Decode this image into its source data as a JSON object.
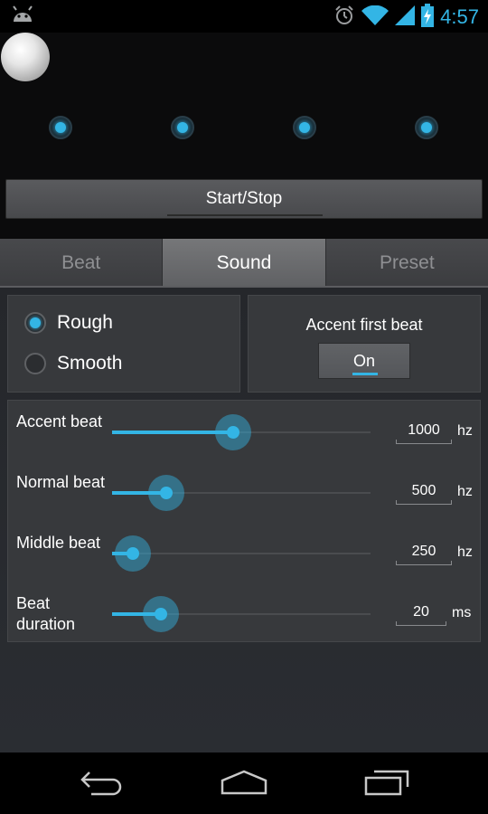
{
  "status_bar": {
    "time": "4:57",
    "icons": [
      "android-icon",
      "alarm-icon",
      "wifi-icon",
      "signal-icon",
      "battery-charging-icon"
    ],
    "accent_color": "#33b5e5"
  },
  "metronome": {
    "beat_count": 4,
    "start_stop_label": "Start/Stop"
  },
  "tabs": [
    {
      "label": "Beat",
      "active": false
    },
    {
      "label": "Sound",
      "active": true
    },
    {
      "label": "Preset",
      "active": false
    }
  ],
  "sound_type": {
    "options": [
      {
        "label": "Rough",
        "checked": true
      },
      {
        "label": "Smooth",
        "checked": false
      }
    ]
  },
  "accent": {
    "title": "Accent first beat",
    "toggle_label": "On",
    "toggle_on": true
  },
  "sliders": [
    {
      "label": "Accent beat",
      "value": "1000",
      "unit": "hz",
      "fraction": 0.47
    },
    {
      "label": "Normal beat",
      "value": "500",
      "unit": "hz",
      "fraction": 0.21
    },
    {
      "label": "Middle beat",
      "value": "250",
      "unit": "hz",
      "fraction": 0.08
    },
    {
      "label": "Beat duration",
      "value": "20",
      "unit": "ms",
      "fraction": 0.19
    }
  ],
  "nav": {
    "icons": [
      "back-icon",
      "home-icon",
      "recents-icon"
    ]
  }
}
